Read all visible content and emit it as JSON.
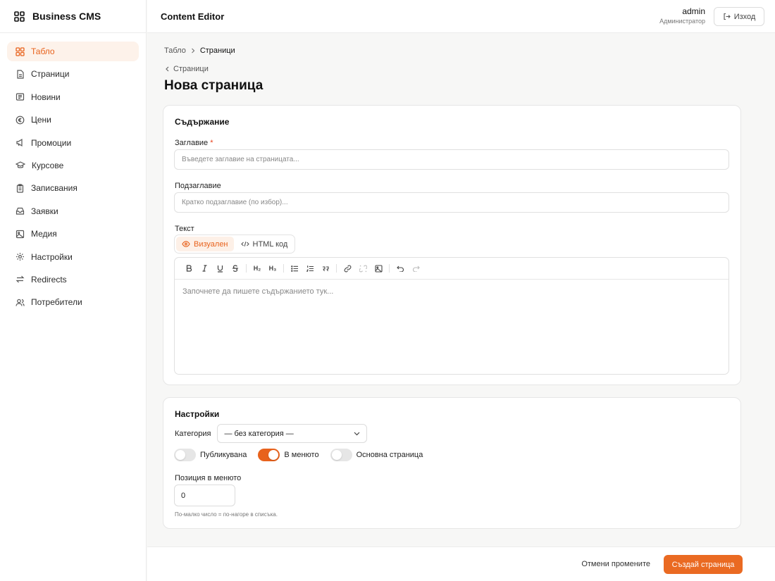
{
  "app": {
    "name": "Business CMS",
    "section_title": "Content Editor"
  },
  "user": {
    "name": "admin",
    "role": "Администратор",
    "logout_label": "Изход"
  },
  "sidebar": {
    "items": [
      {
        "label": "Табло",
        "icon": "dashboard-icon",
        "active": true
      },
      {
        "label": "Страници",
        "icon": "file-icon"
      },
      {
        "label": "Новини",
        "icon": "newspaper-icon"
      },
      {
        "label": "Цени",
        "icon": "currency-icon"
      },
      {
        "label": "Промоции",
        "icon": "megaphone-icon"
      },
      {
        "label": "Курсове",
        "icon": "graduation-cap-icon"
      },
      {
        "label": "Записвания",
        "icon": "clipboard-icon"
      },
      {
        "label": "Заявки",
        "icon": "inbox-icon"
      },
      {
        "label": "Медия",
        "icon": "image-icon"
      },
      {
        "label": "Настройки",
        "icon": "gear-icon"
      },
      {
        "label": "Redirects",
        "icon": "arrows-icon"
      },
      {
        "label": "Потребители",
        "icon": "users-icon"
      }
    ]
  },
  "breadcrumb": {
    "root": "Табло",
    "current": "Страници"
  },
  "back_link": "Страници",
  "page_title": "Нова страница",
  "content_card": {
    "title": "Съдържание",
    "title_field": {
      "label": "Заглавие",
      "required_mark": "*",
      "placeholder": "Въведете заглавие на страницата..."
    },
    "subtitle_field": {
      "label": "Подзаглавие",
      "placeholder": "Кратко подзаглавие (по избор)..."
    },
    "text_label": "Текст",
    "modes": {
      "visual": "Визуален",
      "html": "HTML код"
    },
    "toolbar": {
      "h2": "H₂",
      "h3": "H₃"
    },
    "editor_placeholder": "Започнете да пишете съдържанието тук..."
  },
  "settings_card": {
    "title": "Настройки",
    "category_label": "Категория",
    "category_value": "— без категория —",
    "toggles": [
      {
        "label": "Публикувана",
        "on": false
      },
      {
        "label": "В менюто",
        "on": true
      },
      {
        "label": "Основна страница",
        "on": false
      }
    ],
    "position_label": "Позиция в менюто",
    "position_value": "0",
    "position_hint": "По-малко число = по-нагоре в списъка."
  },
  "footer": {
    "cancel_label": "Отмени промените",
    "submit_label": "Създай страница"
  },
  "colors": {
    "accent": "#e8621c",
    "accent_bg": "#fdf2ea"
  }
}
